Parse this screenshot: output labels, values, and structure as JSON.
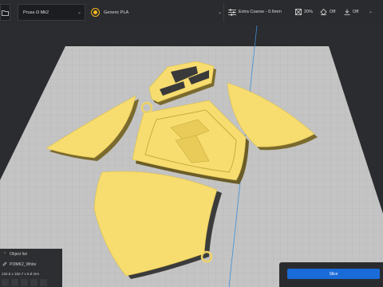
{
  "toolbar": {
    "printer": "Prusa i3 Mk2",
    "material": "Generic PLA",
    "profile": "Extra Coarse - 0.6mm",
    "infill": "20%",
    "support": "Off",
    "adhesion": "Off"
  },
  "object_panel": {
    "header": "Object list",
    "file_name": "PI3MK2_White",
    "dimensions": "132.5 x 152.7 x 5.9 mm"
  },
  "actions": {
    "slice_label": "Slice"
  },
  "colors": {
    "accent": "#196bd8",
    "model": "#f7dc6f",
    "bed": "#c4c4c4",
    "toolbar": "#2a2b2e"
  },
  "icons": [
    "folder-icon",
    "printer-chevron-icon",
    "material-swatch-icon",
    "material-chevron-icon",
    "settings-sliders-icon",
    "infill-icon",
    "support-icon",
    "adhesion-icon",
    "settings-chevron-icon",
    "edit-icon",
    "view-cube-icon"
  ]
}
